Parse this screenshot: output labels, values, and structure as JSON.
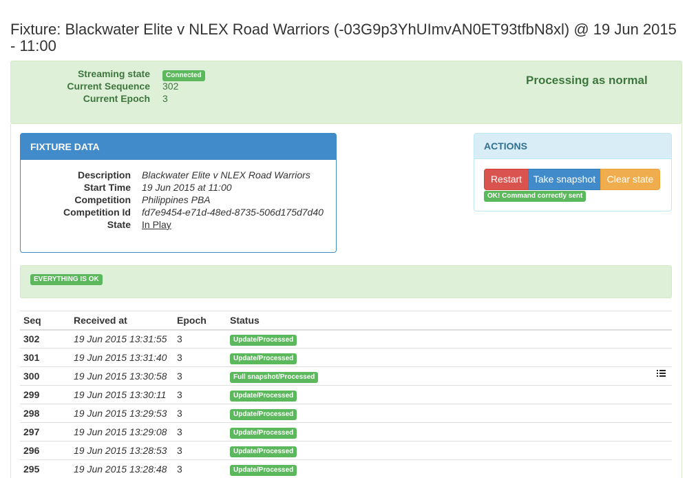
{
  "page": {
    "title": "Fixture: Blackwater Elite v NLEX Road Warriors (-03G9p3YhUImvAN0ET93tfbN8xl) @ 19 Jun 2015 - 11:00"
  },
  "streaming": {
    "state_label": "Streaming state",
    "state_value": "Connected",
    "sequence_label": "Current Sequence",
    "sequence_value": "302",
    "epoch_label": "Current Epoch",
    "epoch_value": "3",
    "processing_text": "Processing as normal"
  },
  "fixture_panel": {
    "header": "FIXTURE DATA",
    "rows": [
      {
        "label": "Description",
        "value": "Blackwater Elite v NLEX Road Warriors"
      },
      {
        "label": "Start Time",
        "value": "19 Jun 2015 at 11:00"
      },
      {
        "label": "Competition",
        "value": "Philippines PBA"
      },
      {
        "label": "Competition Id",
        "value": "fd7e9454-e71d-48ed-8735-506d175d7d40"
      },
      {
        "label": "State",
        "value": "In Play"
      }
    ]
  },
  "actions_panel": {
    "header": "ACTIONS",
    "restart_label": "Restart",
    "snapshot_label": "Take snapshot",
    "clear_label": "Clear state",
    "command_status": "OK! Command correctly sent"
  },
  "health": {
    "badge": "EVERYTHING IS OK"
  },
  "sequence_table": {
    "columns": [
      "Seq",
      "Received at",
      "Epoch",
      "Status"
    ],
    "rows": [
      {
        "seq": "302",
        "received": "19 Jun 2015 13:31:55",
        "epoch": "3",
        "status": "Update/Processed",
        "has_icon": false
      },
      {
        "seq": "301",
        "received": "19 Jun 2015 13:31:40",
        "epoch": "3",
        "status": "Update/Processed",
        "has_icon": false
      },
      {
        "seq": "300",
        "received": "19 Jun 2015 13:30:58",
        "epoch": "3",
        "status": "Full snapshot/Processed",
        "has_icon": true
      },
      {
        "seq": "299",
        "received": "19 Jun 2015 13:30:11",
        "epoch": "3",
        "status": "Update/Processed",
        "has_icon": false
      },
      {
        "seq": "298",
        "received": "19 Jun 2015 13:29:53",
        "epoch": "3",
        "status": "Update/Processed",
        "has_icon": false
      },
      {
        "seq": "297",
        "received": "19 Jun 2015 13:29:08",
        "epoch": "3",
        "status": "Update/Processed",
        "has_icon": false
      },
      {
        "seq": "296",
        "received": "19 Jun 2015 13:28:53",
        "epoch": "3",
        "status": "Update/Processed",
        "has_icon": false
      },
      {
        "seq": "295",
        "received": "19 Jun 2015 13:28:48",
        "epoch": "3",
        "status": "Update/Processed",
        "has_icon": false
      }
    ]
  },
  "colors": {
    "success": "#5cb85c",
    "success_bg": "#dff0d8",
    "primary": "#428bca",
    "danger": "#d9534f",
    "warning": "#f0ad4e",
    "info_bg": "#d9edf7"
  }
}
